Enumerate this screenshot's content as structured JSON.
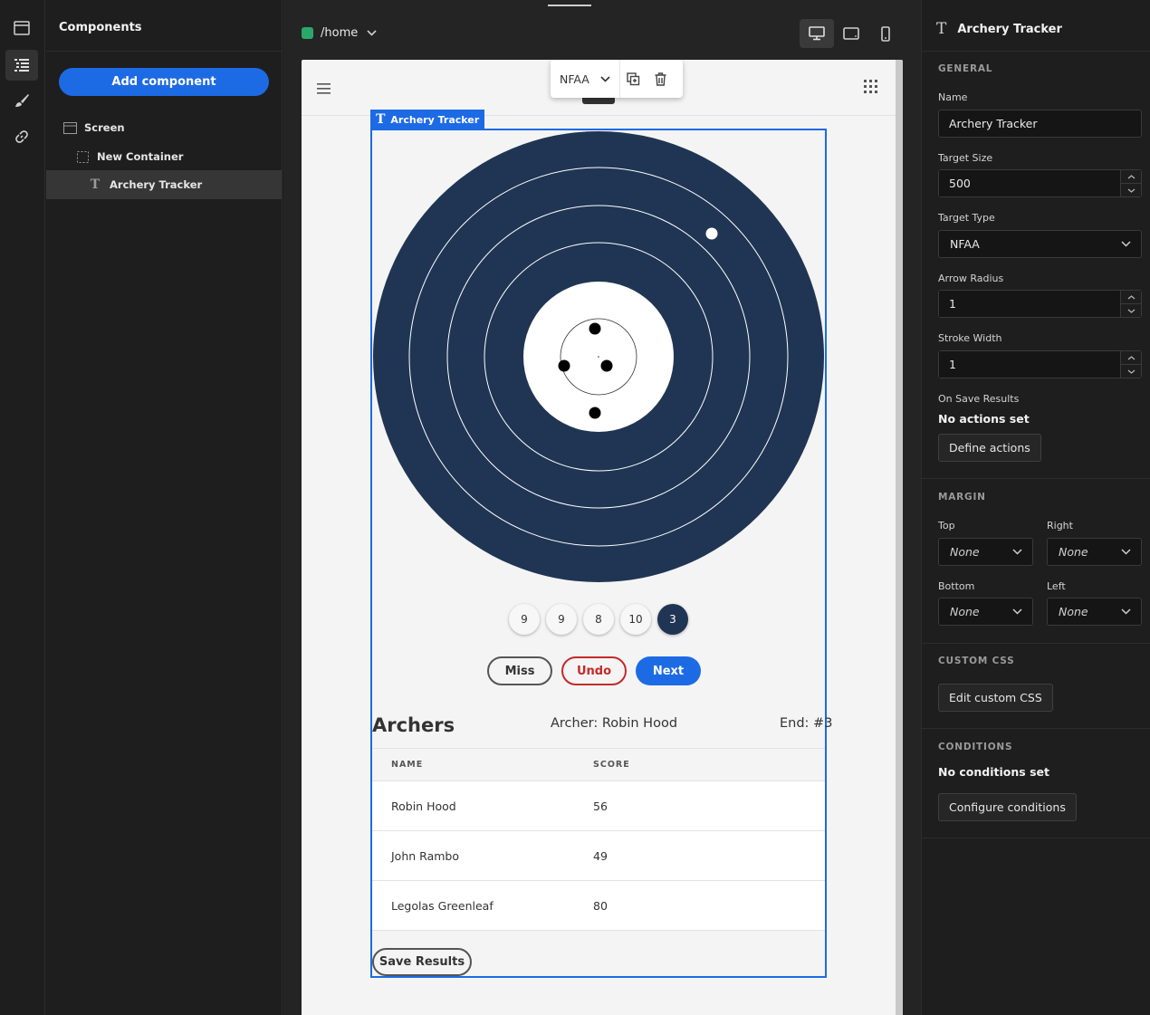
{
  "components_panel": {
    "title": "Components",
    "add_button": "Add component",
    "tree": [
      {
        "label": "Screen"
      },
      {
        "label": "New Container"
      },
      {
        "label": "Archery Tracker"
      }
    ]
  },
  "center": {
    "route": "/home",
    "floating_toolbar": {
      "target_type": "NFAA"
    },
    "selection_label": "Archery Tracker",
    "scores": [
      "9",
      "9",
      "8",
      "10",
      "3"
    ],
    "buttons": {
      "miss": "Miss",
      "undo": "Undo",
      "next": "Next",
      "save": "Save Results"
    },
    "archers_heading": "Archers",
    "current_archer": "Archer: Robin Hood",
    "end": "End: #3",
    "table": {
      "headers": [
        "NAME",
        "SCORE"
      ],
      "rows": [
        {
          "name": "Robin Hood",
          "score": "56"
        },
        {
          "name": "John Rambo",
          "score": "49"
        },
        {
          "name": "Legolas Greenleaf",
          "score": "80"
        }
      ]
    },
    "colors": {
      "target_navy": "#1f3553",
      "accent": "#1d6ae5",
      "undo_red": "#c62828"
    }
  },
  "right_panel": {
    "title": "Archery Tracker",
    "general": {
      "heading": "GENERAL",
      "name_label": "Name",
      "name_value": "Archery Tracker",
      "target_size_label": "Target Size",
      "target_size_value": "500",
      "target_type_label": "Target Type",
      "target_type_value": "NFAA",
      "arrow_radius_label": "Arrow Radius",
      "arrow_radius_value": "1",
      "stroke_width_label": "Stroke Width",
      "stroke_width_value": "1",
      "on_save_label": "On Save Results",
      "on_save_note": "No actions set",
      "define_actions": "Define actions"
    },
    "margin": {
      "heading": "MARGIN",
      "top_label": "Top",
      "top_value": "None",
      "right_label": "Right",
      "right_value": "None",
      "bottom_label": "Bottom",
      "bottom_value": "None",
      "left_label": "Left",
      "left_value": "None"
    },
    "custom_css": {
      "heading": "CUSTOM CSS",
      "button": "Edit custom CSS"
    },
    "conditions": {
      "heading": "CONDITIONS",
      "note": "No conditions set",
      "button": "Configure conditions"
    }
  }
}
